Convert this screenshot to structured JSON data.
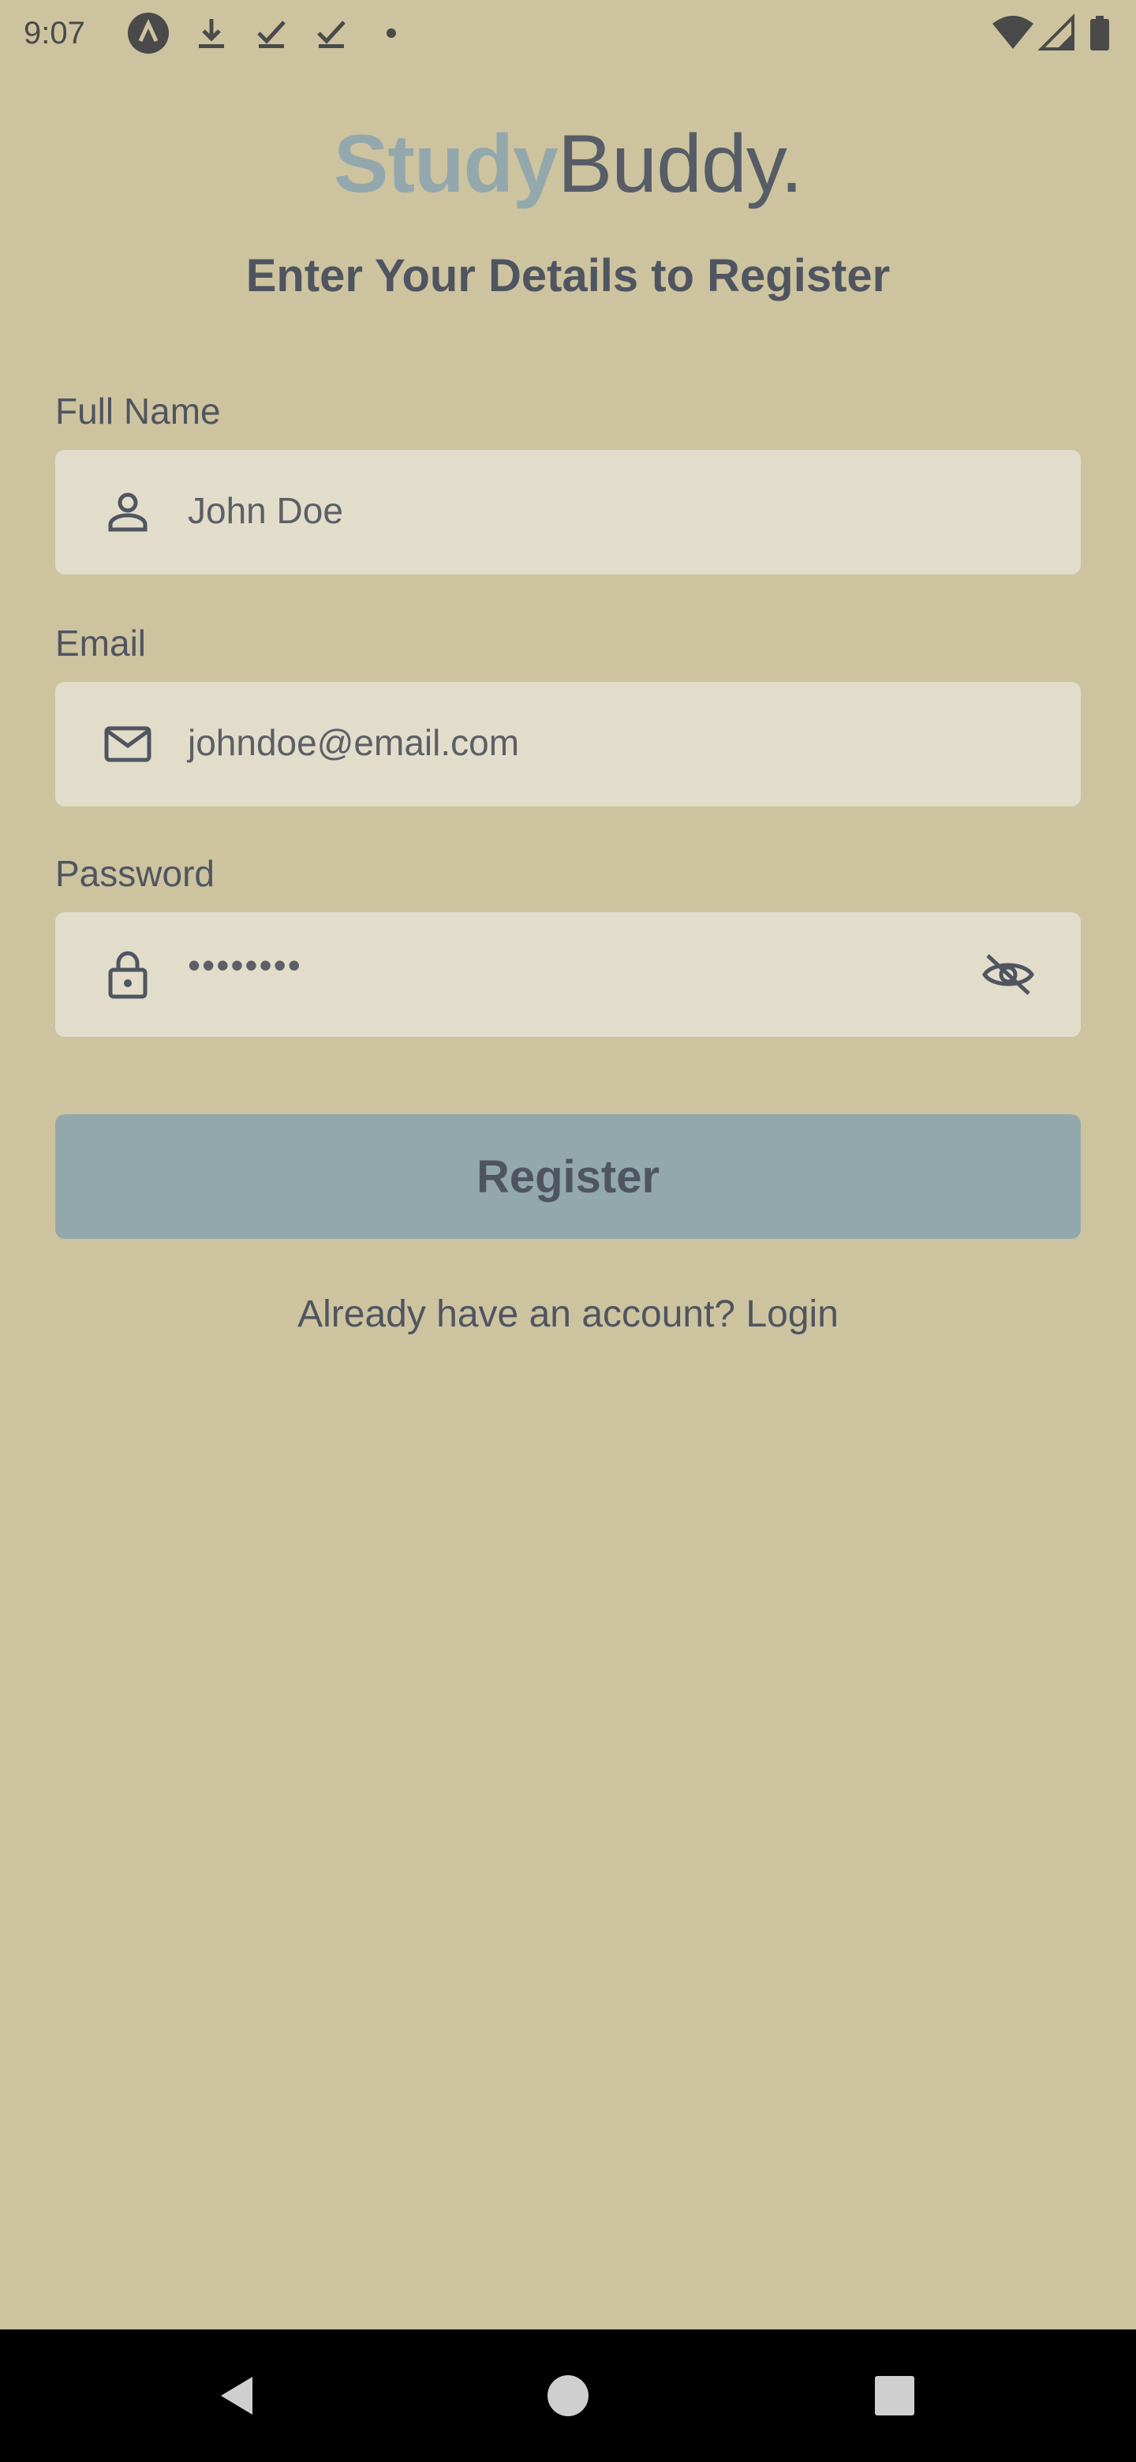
{
  "status_bar": {
    "time": "9:07",
    "icons": [
      "app-notification-icon",
      "download-icon",
      "check-icon",
      "check-icon",
      "dot-icon",
      "wifi-icon",
      "signal-icon",
      "battery-icon"
    ]
  },
  "logo": {
    "part1": "Study",
    "part2": "Buddy."
  },
  "subtitle": "Enter Your Details to Register",
  "form": {
    "full_name": {
      "label": "Full Name",
      "value": "John Doe",
      "icon": "person-icon"
    },
    "email": {
      "label": "Email",
      "value": "johndoe@email.com",
      "icon": "mail-icon"
    },
    "password": {
      "label": "Password",
      "value": "••••••••",
      "icon": "lock-icon",
      "trailing_icon": "visibility-off-icon"
    }
  },
  "register_button": "Register",
  "login_link": "Already have an account? Login",
  "colors": {
    "background": "#cdc39f",
    "field": "#e2dcca",
    "button": "#92a8ad",
    "accent": "#93a8ad",
    "text": "#4f5560"
  },
  "nav_bar": {
    "icons": [
      "back-icon",
      "home-icon",
      "recents-icon"
    ]
  }
}
